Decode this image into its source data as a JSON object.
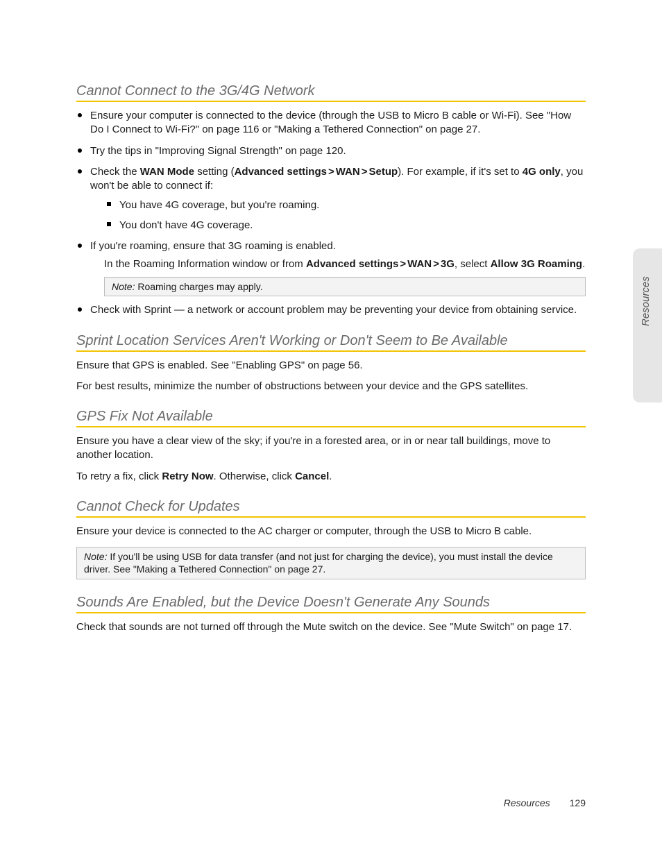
{
  "sideTab": "Resources",
  "sections": {
    "s1": {
      "title": "Cannot Connect to the 3G/4G Network",
      "b1": "Ensure your computer is connected to the device (through the USB to Micro B cable or Wi-Fi). See \"How Do I Connect to Wi-Fi?\" on page 116 or \"Making a Tethered Connection\" on page 27.",
      "b2": "Try the tips in \"Improving Signal Strength\" on page 120.",
      "b3_pre": "Check the ",
      "b3_wan_mode": "WAN Mode",
      "b3_mid1": " setting (",
      "b3_adv": "Advanced settings",
      "b3_wan": "WAN",
      "b3_setup": "Setup",
      "b3_mid2": "). For example, if it's set to ",
      "b3_4g": "4G only",
      "b3_post": ", you won't be able to connect if:",
      "b3_s1": "You have 4G coverage, but you're roaming.",
      "b3_s2": "You don't have 4G coverage.",
      "b4": "If you're roaming, ensure that 3G roaming is enabled.",
      "b4_sub_pre": "In the Roaming Information window or from ",
      "b4_adv": "Advanced settings",
      "b4_wan": "WAN",
      "b4_3g": "3G",
      "b4_sub_mid": ", select ",
      "b4_allow": "Allow 3G Roaming",
      "b4_sub_post": ".",
      "note1_label": "Note:",
      "note1_text": "  Roaming charges may apply.",
      "b5": "Check with Sprint — a network or account problem may be preventing your device from obtaining service."
    },
    "s2": {
      "title": "Sprint Location Services Aren't Working or Don't Seem to Be Available",
      "p1": "Ensure that GPS is enabled. See \"Enabling GPS\" on page 56.",
      "p2": "For best results, minimize the number of obstructions between your device and the GPS satellites."
    },
    "s3": {
      "title": "GPS Fix Not Available",
      "p1": "Ensure you have a clear view of the sky; if you're in a forested area, or in or near tall buildings, move to another location.",
      "p2_pre": "To retry a fix, click ",
      "p2_retry": "Retry Now",
      "p2_mid": ". Otherwise, click ",
      "p2_cancel": "Cancel",
      "p2_post": "."
    },
    "s4": {
      "title": "Cannot Check for Updates",
      "p1": "Ensure your device is connected to the AC charger or computer, through the USB to Micro B cable.",
      "note_label": "Note:",
      "note_text": "  If you'll be using USB for data transfer (and not just for charging the device), you must install the device driver. See \"Making a Tethered Connection\" on page 27."
    },
    "s5": {
      "title": "Sounds Are Enabled, but the Device Doesn't Generate Any Sounds",
      "p1": "Check that sounds are not turned off through the Mute switch on the device. See \"Mute Switch\" on page 17."
    }
  },
  "footer": {
    "label": "Resources",
    "page": "129"
  },
  "glyphs": {
    "chev": ">"
  }
}
